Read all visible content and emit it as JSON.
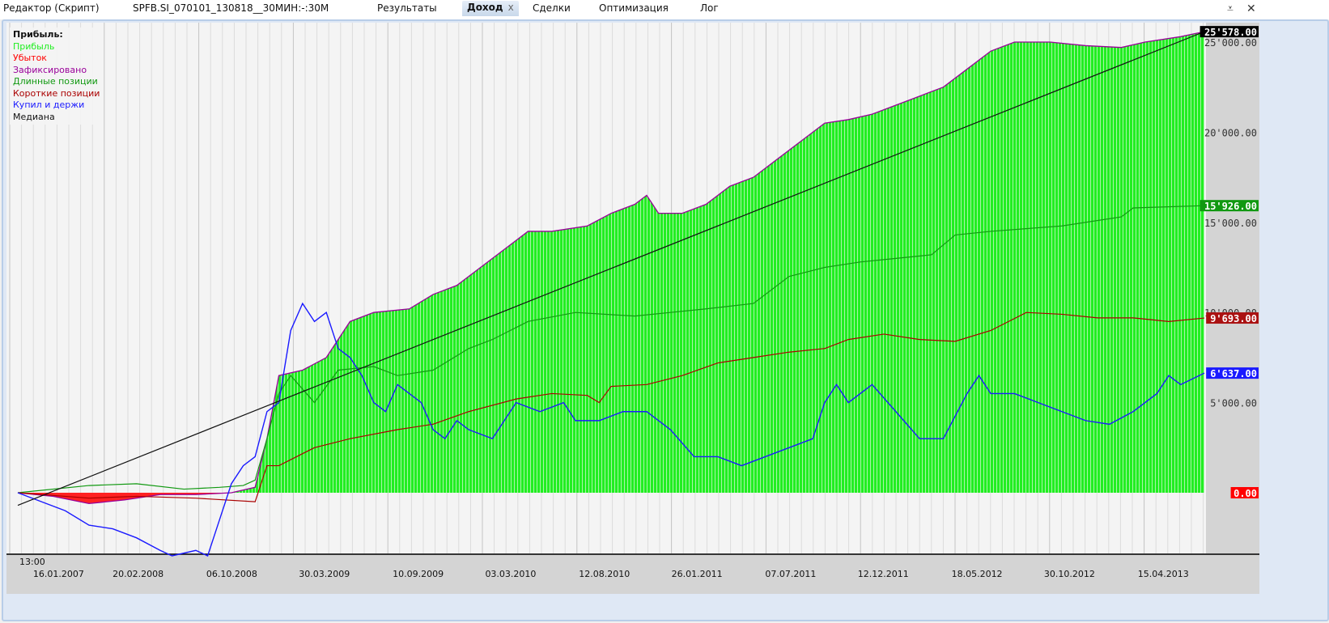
{
  "tabs": [
    {
      "label": "Редактор (Скрипт)",
      "active": false
    },
    {
      "label": "SPFB.SI_070101_130818__30МИН:-:30M",
      "active": false
    },
    {
      "label": "Результаты",
      "active": false
    },
    {
      "label": "Доход",
      "active": true,
      "close": "x"
    },
    {
      "label": "Сделки",
      "active": false
    },
    {
      "label": "Оптимизация",
      "active": false
    },
    {
      "label": "Лог",
      "active": false
    }
  ],
  "window_buttons": {
    "menu": "menu-down-icon",
    "close": "close-icon"
  },
  "legend": {
    "title": "Прибыль:",
    "items": [
      {
        "label": "Прибыль",
        "color": "#22ee22"
      },
      {
        "label": "Убыток",
        "color": "#ff0000"
      },
      {
        "label": "Зафиксировано",
        "color": "#990099"
      },
      {
        "label": "Длинные позиции",
        "color": "#119911"
      },
      {
        "label": "Короткие позиции",
        "color": "#aa0000"
      },
      {
        "label": "Купил и держи",
        "color": "#1a1aff"
      },
      {
        "label": "Медиана",
        "color": "#111111"
      }
    ]
  },
  "chart_data": {
    "type": "line",
    "x_unit": "time index 0-100 (16.01.2007 to 18.08.2013)",
    "x_time_label": "13:00",
    "x_tick_labels": [
      "16.01.2007",
      "20.02.2008",
      "06.10.2008",
      "30.03.2009",
      "10.09.2009",
      "03.03.2010",
      "12.08.2010",
      "26.01.2011",
      "07.07.2011",
      "12.12.2011",
      "18.05.2012",
      "30.10.2012",
      "15.04.2013"
    ],
    "x_tick_positions": [
      1.8,
      8.5,
      16.4,
      24.2,
      32.1,
      39.9,
      47.8,
      55.6,
      63.5,
      71.3,
      79.2,
      87.0,
      94.9
    ],
    "y_tick_labels": [
      "0.00",
      "5'000.00",
      "10'000.00",
      "15'000.00",
      "20'000.00",
      "25'000.00"
    ],
    "y_ticks": [
      0,
      5000,
      10000,
      15000,
      20000,
      25000
    ],
    "ylim": [
      -3800,
      27000
    ],
    "last_values": [
      {
        "label": "25'578.00",
        "value": 25578,
        "bg": "#000000",
        "fg": "#ffffff"
      },
      {
        "label": "15'926.00",
        "value": 15926,
        "bg": "#119911",
        "fg": "#ffffff"
      },
      {
        "label": "9'693.00",
        "value": 9693,
        "bg": "#aa1111",
        "fg": "#ffffff"
      },
      {
        "label": "6'637.00",
        "value": 6637,
        "bg": "#1a1aff",
        "fg": "#ffffff"
      },
      {
        "label": "0.00",
        "value": 0,
        "bg": "#ff0000",
        "fg": "#ffffff"
      }
    ],
    "series": [
      {
        "name": "Прибыль",
        "color": "#22ee22",
        "points": [
          [
            0,
            0
          ],
          [
            3,
            -200
          ],
          [
            6,
            -600
          ],
          [
            9,
            -400
          ],
          [
            12,
            -100
          ],
          [
            15,
            -100
          ],
          [
            18,
            0
          ],
          [
            20,
            300
          ],
          [
            21,
            3000
          ],
          [
            22,
            6500
          ],
          [
            24,
            6800
          ],
          [
            26,
            7500
          ],
          [
            28,
            9500
          ],
          [
            30,
            10000
          ],
          [
            33,
            10200
          ],
          [
            35,
            11000
          ],
          [
            37,
            11500
          ],
          [
            39,
            12500
          ],
          [
            41,
            13500
          ],
          [
            43,
            14500
          ],
          [
            45,
            14500
          ],
          [
            48,
            14800
          ],
          [
            50,
            15500
          ],
          [
            52,
            16000
          ],
          [
            53,
            16500
          ],
          [
            54,
            15500
          ],
          [
            56,
            15500
          ],
          [
            58,
            16000
          ],
          [
            60,
            17000
          ],
          [
            62,
            17500
          ],
          [
            64,
            18500
          ],
          [
            66,
            19500
          ],
          [
            68,
            20500
          ],
          [
            70,
            20700
          ],
          [
            72,
            21000
          ],
          [
            74,
            21500
          ],
          [
            76,
            22000
          ],
          [
            78,
            22500
          ],
          [
            80,
            23500
          ],
          [
            82,
            24500
          ],
          [
            84,
            25000
          ],
          [
            87,
            25000
          ],
          [
            90,
            24800
          ],
          [
            93,
            24700
          ],
          [
            95,
            25000
          ],
          [
            98,
            25300
          ],
          [
            100,
            25578
          ]
        ]
      },
      {
        "name": "Длинные позиции",
        "color": "#119911",
        "points": [
          [
            0,
            0
          ],
          [
            6,
            400
          ],
          [
            10,
            500
          ],
          [
            14,
            200
          ],
          [
            17,
            300
          ],
          [
            19,
            400
          ],
          [
            20,
            700
          ],
          [
            21,
            3000
          ],
          [
            22,
            5500
          ],
          [
            23,
            6500
          ],
          [
            25,
            5000
          ],
          [
            27,
            6800
          ],
          [
            30,
            7000
          ],
          [
            32,
            6500
          ],
          [
            35,
            6800
          ],
          [
            38,
            8000
          ],
          [
            40,
            8500
          ],
          [
            43,
            9500
          ],
          [
            47,
            10000
          ],
          [
            52,
            9800
          ],
          [
            55,
            10000
          ],
          [
            58,
            10200
          ],
          [
            62,
            10500
          ],
          [
            65,
            12000
          ],
          [
            68,
            12500
          ],
          [
            71,
            12800
          ],
          [
            74,
            13000
          ],
          [
            77,
            13200
          ],
          [
            79,
            14300
          ],
          [
            82,
            14500
          ],
          [
            88,
            14800
          ],
          [
            93,
            15300
          ],
          [
            94,
            15800
          ],
          [
            100,
            15926
          ]
        ]
      },
      {
        "name": "Короткие позиции",
        "color": "#aa0000",
        "points": [
          [
            0,
            0
          ],
          [
            6,
            -300
          ],
          [
            10,
            -200
          ],
          [
            15,
            -300
          ],
          [
            20,
            -500
          ],
          [
            21,
            1500
          ],
          [
            22,
            1500
          ],
          [
            25,
            2500
          ],
          [
            28,
            3000
          ],
          [
            32,
            3500
          ],
          [
            35,
            3800
          ],
          [
            38,
            4500
          ],
          [
            42,
            5200
          ],
          [
            45,
            5500
          ],
          [
            48,
            5400
          ],
          [
            49,
            5000
          ],
          [
            50,
            5900
          ],
          [
            53,
            6000
          ],
          [
            56,
            6500
          ],
          [
            59,
            7200
          ],
          [
            62,
            7500
          ],
          [
            65,
            7800
          ],
          [
            68,
            8000
          ],
          [
            70,
            8500
          ],
          [
            73,
            8800
          ],
          [
            76,
            8500
          ],
          [
            79,
            8400
          ],
          [
            82,
            9000
          ],
          [
            85,
            10000
          ],
          [
            88,
            9900
          ],
          [
            91,
            9700
          ],
          [
            94,
            9700
          ],
          [
            97,
            9500
          ],
          [
            100,
            9693
          ]
        ]
      },
      {
        "name": "Купил и держи",
        "color": "#1a1aff",
        "points": [
          [
            0,
            0
          ],
          [
            2,
            -500
          ],
          [
            4,
            -1000
          ],
          [
            6,
            -1800
          ],
          [
            8,
            -2000
          ],
          [
            10,
            -2500
          ],
          [
            12,
            -3200
          ],
          [
            13,
            -3500
          ],
          [
            15,
            -3200
          ],
          [
            16,
            -3500
          ],
          [
            17,
            -1500
          ],
          [
            18,
            500
          ],
          [
            19,
            1500
          ],
          [
            20,
            2000
          ],
          [
            21,
            4500
          ],
          [
            22,
            5000
          ],
          [
            23,
            9000
          ],
          [
            24,
            10500
          ],
          [
            25,
            9500
          ],
          [
            26,
            10000
          ],
          [
            27,
            8000
          ],
          [
            28,
            7500
          ],
          [
            29,
            6500
          ],
          [
            30,
            5000
          ],
          [
            31,
            4500
          ],
          [
            32,
            6000
          ],
          [
            33,
            5500
          ],
          [
            34,
            5000
          ],
          [
            35,
            3500
          ],
          [
            36,
            3000
          ],
          [
            37,
            4000
          ],
          [
            38,
            3500
          ],
          [
            40,
            3000
          ],
          [
            42,
            5000
          ],
          [
            44,
            4500
          ],
          [
            46,
            5000
          ],
          [
            47,
            4000
          ],
          [
            49,
            4000
          ],
          [
            51,
            4500
          ],
          [
            53,
            4500
          ],
          [
            55,
            3500
          ],
          [
            57,
            2000
          ],
          [
            59,
            2000
          ],
          [
            61,
            1500
          ],
          [
            63,
            2000
          ],
          [
            65,
            2500
          ],
          [
            67,
            3000
          ],
          [
            68,
            5000
          ],
          [
            69,
            6000
          ],
          [
            70,
            5000
          ],
          [
            72,
            6000
          ],
          [
            74,
            4500
          ],
          [
            76,
            3000
          ],
          [
            78,
            3000
          ],
          [
            80,
            5500
          ],
          [
            81,
            6500
          ],
          [
            82,
            5500
          ],
          [
            84,
            5500
          ],
          [
            86,
            5000
          ],
          [
            88,
            4500
          ],
          [
            90,
            4000
          ],
          [
            92,
            3800
          ],
          [
            94,
            4500
          ],
          [
            96,
            5500
          ],
          [
            97,
            6500
          ],
          [
            98,
            6000
          ],
          [
            100,
            6637
          ]
        ]
      },
      {
        "name": "Медиана",
        "color": "#111111",
        "points": [
          [
            0,
            -700
          ],
          [
            100,
            25578
          ]
        ]
      }
    ]
  }
}
